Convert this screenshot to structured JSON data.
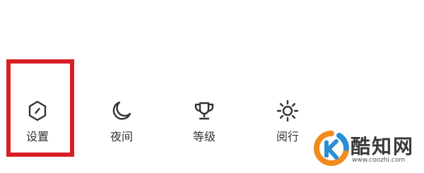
{
  "menu": {
    "items": [
      {
        "label": "设置",
        "icon": "hexagon-settings-icon",
        "highlighted": true
      },
      {
        "label": "夜间",
        "icon": "moon-icon"
      },
      {
        "label": "等级",
        "icon": "trophy-icon"
      },
      {
        "label": "阅行",
        "icon": "sun-icon"
      }
    ]
  },
  "highlight_color": "#d81e25",
  "watermark": {
    "name": "酷知网",
    "url": "www.coozhi.com",
    "logo_colors": [
      "#f08c1e",
      "#2a8fd4"
    ]
  }
}
